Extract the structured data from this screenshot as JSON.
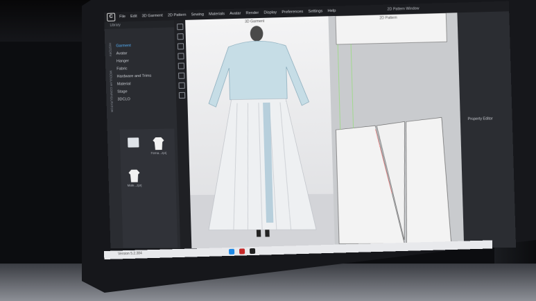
{
  "menubar": {
    "logo": "C",
    "items": [
      "File",
      "Edit",
      "3D Garment",
      "2D Pattern",
      "Sewing",
      "Materials",
      "Avatar",
      "Render",
      "Display",
      "Preferences",
      "Settings",
      "Help"
    ],
    "window_title": "2D Pattern Window"
  },
  "library": {
    "tab": "Library",
    "vertical_labels": [
      "HISTORY",
      "MODULAR CONFIGURATOR"
    ],
    "items": [
      "Garment",
      "Avatar",
      "Hanger",
      "Fabric",
      "Hardware and Trims",
      "Material",
      "Stage",
      "3DCLO"
    ],
    "thumbs": [
      {
        "caption": ""
      },
      {
        "caption": "Fema...zprj"
      },
      {
        "caption": "Male...zprj"
      }
    ]
  },
  "view3d": {
    "label": "3D Garment"
  },
  "view2d": {
    "label": "2D Pattern"
  },
  "properties": {
    "title": "Property Editor"
  },
  "status": {
    "version": "Version 5.2.384"
  }
}
